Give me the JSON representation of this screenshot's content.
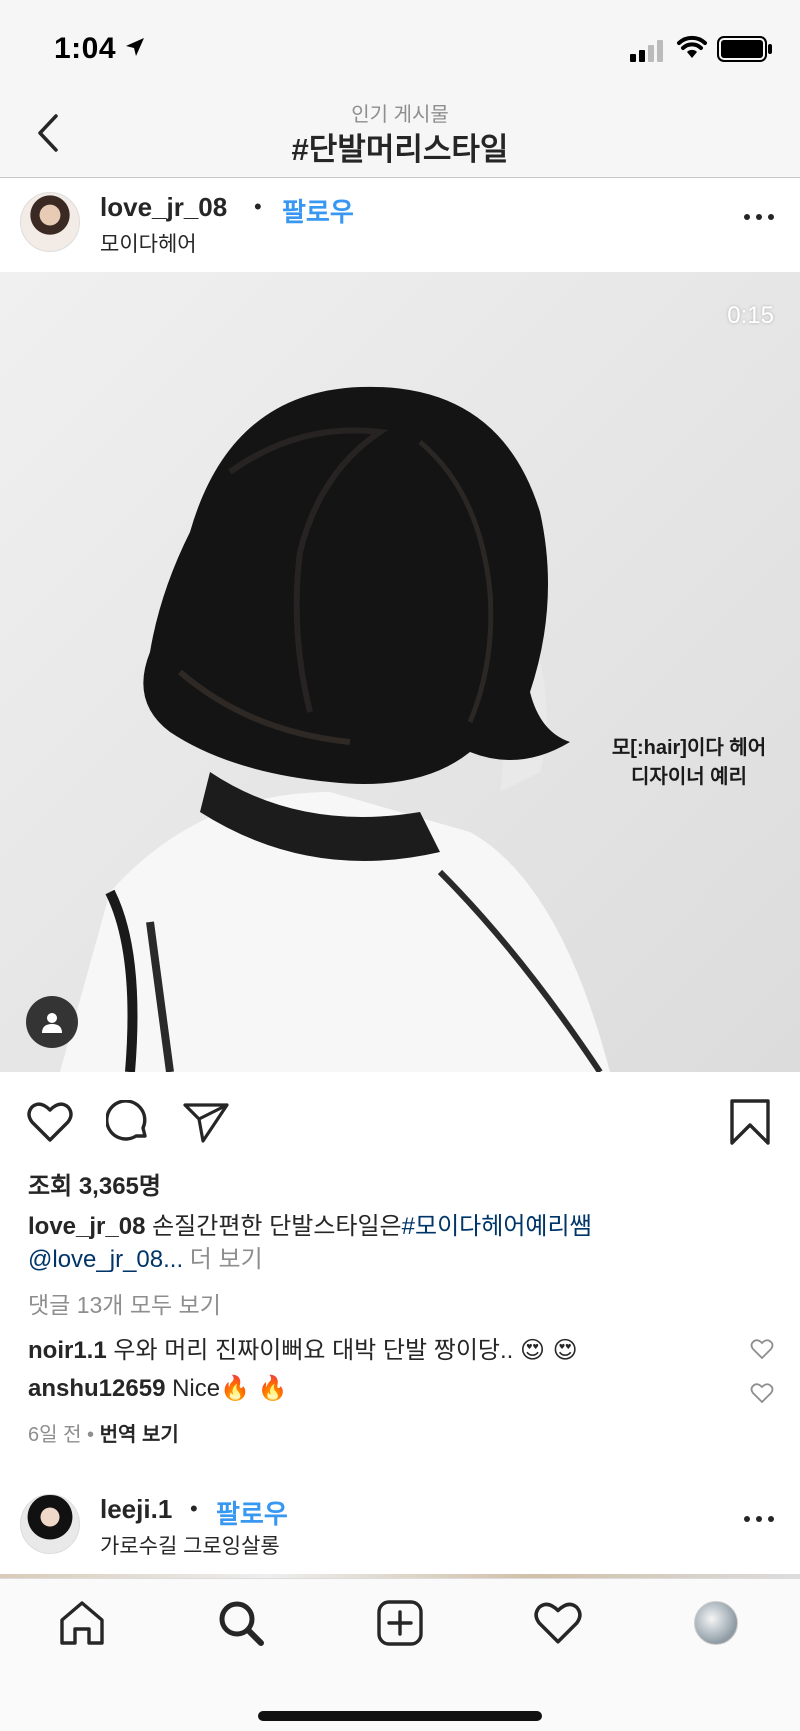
{
  "status_bar": {
    "time": "1:04"
  },
  "header": {
    "subtitle": "인기 게시물",
    "title": "#단발머리스타일"
  },
  "post": {
    "username": "love_jr_08",
    "follow_label": "팔로우",
    "location": "모이다헤어",
    "video_time": "0:15",
    "overlay_line1": "모[:hair]이다 헤어",
    "overlay_line2": "디자이너 예리",
    "views": "조회 3,365명",
    "caption_user": "love_jr_08",
    "caption_text": "손질간편한 단발스타일은",
    "caption_tag": "#모이다헤어예리쌤",
    "caption_mention": "@love_jr_08...",
    "caption_more": "더 보기",
    "view_all_comments": "댓글 13개 모두 보기",
    "comments": [
      {
        "user": "noir1.1",
        "text": "우와 머리 진짜이뻐요 대박 단발 짱이당..",
        "emoji": "😍 😍"
      },
      {
        "user": "anshu12659",
        "text": "Nice",
        "emoji": "🔥 🔥"
      }
    ],
    "time_ago": "6일 전",
    "translate_label": "번역 보기"
  },
  "next_post": {
    "username": "leeji.1",
    "follow_label": "팔로우",
    "location": "가로수길 그로잉살롱"
  },
  "tabs": [
    {
      "icon": "home-icon"
    },
    {
      "icon": "search-icon",
      "active": true
    },
    {
      "icon": "add-post-icon"
    },
    {
      "icon": "activity-heart-icon"
    },
    {
      "icon": "profile-avatar"
    }
  ],
  "colors": {
    "link_blue": "#3897f0",
    "hashtag": "#003569",
    "secondary_text": "#8e8e8e",
    "primary_text": "#262626"
  }
}
